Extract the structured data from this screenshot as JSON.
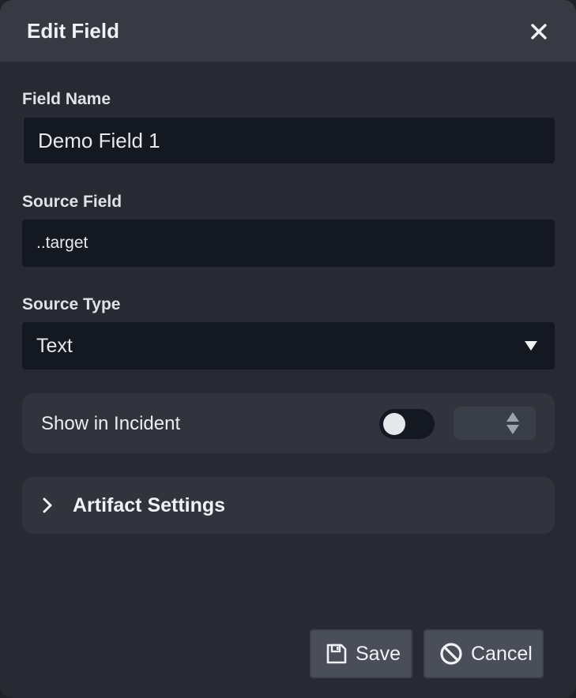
{
  "dialog": {
    "title": "Edit Field",
    "close_icon": "close-icon"
  },
  "form": {
    "field_name": {
      "label": "Field Name",
      "value": "Demo Field 1"
    },
    "source_field": {
      "label": "Source Field",
      "value": "..target"
    },
    "source_type": {
      "label": "Source Type",
      "selected": "Text",
      "icon": "caret-down-icon"
    },
    "show_in_incident": {
      "label": "Show in Incident",
      "toggle_on": false,
      "stepper_value": ""
    },
    "artifact_settings": {
      "label": "Artifact Settings",
      "icon": "chevron-right-icon",
      "expanded": false
    }
  },
  "footer": {
    "save_label": "Save",
    "save_icon": "floppy-disk-icon",
    "cancel_label": "Cancel",
    "cancel_icon": "ban-icon"
  },
  "colors": {
    "dialog_bg": "#272a32",
    "header_bg": "#373a43",
    "input_bg": "#141821",
    "panel_bg": "#31343c",
    "button_bg": "#4a4e58"
  }
}
